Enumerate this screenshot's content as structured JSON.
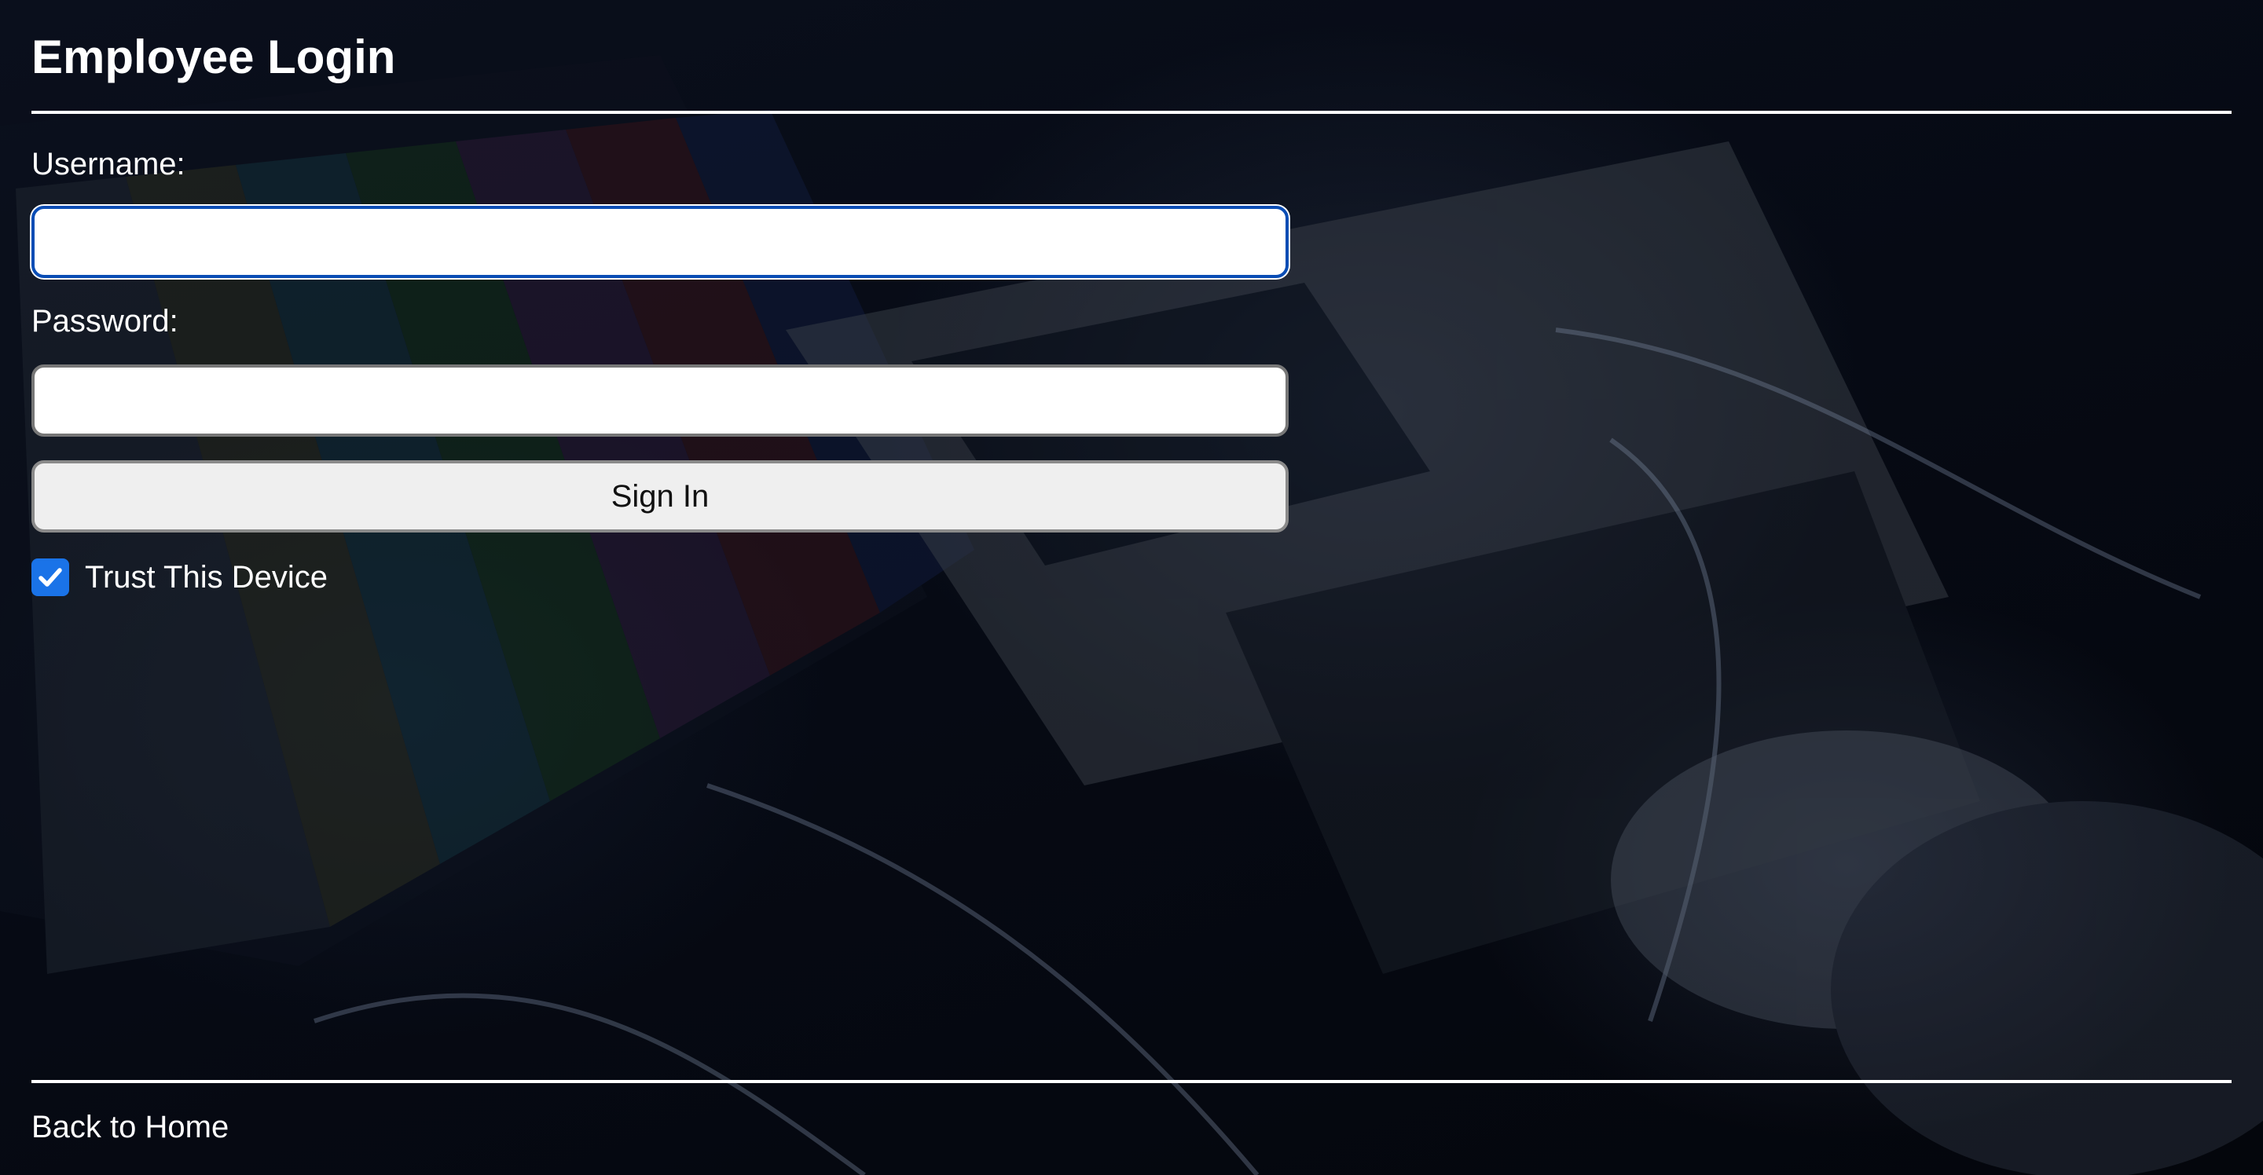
{
  "login": {
    "title": "Employee Login",
    "username_label": "Username:",
    "username_value": "",
    "password_label": "Password:",
    "password_value": "",
    "submit_label": "Sign In",
    "trust_label": "Trust This Device",
    "trust_checked": true
  },
  "footer": {
    "home_link": "Back to Home"
  },
  "colors": {
    "focus_border": "#0a4db5",
    "checkbox": "#1a73e8",
    "button_bg": "#efefef",
    "text": "#ffffff"
  },
  "icons": {
    "checkbox_mark": "checkmark-icon"
  }
}
